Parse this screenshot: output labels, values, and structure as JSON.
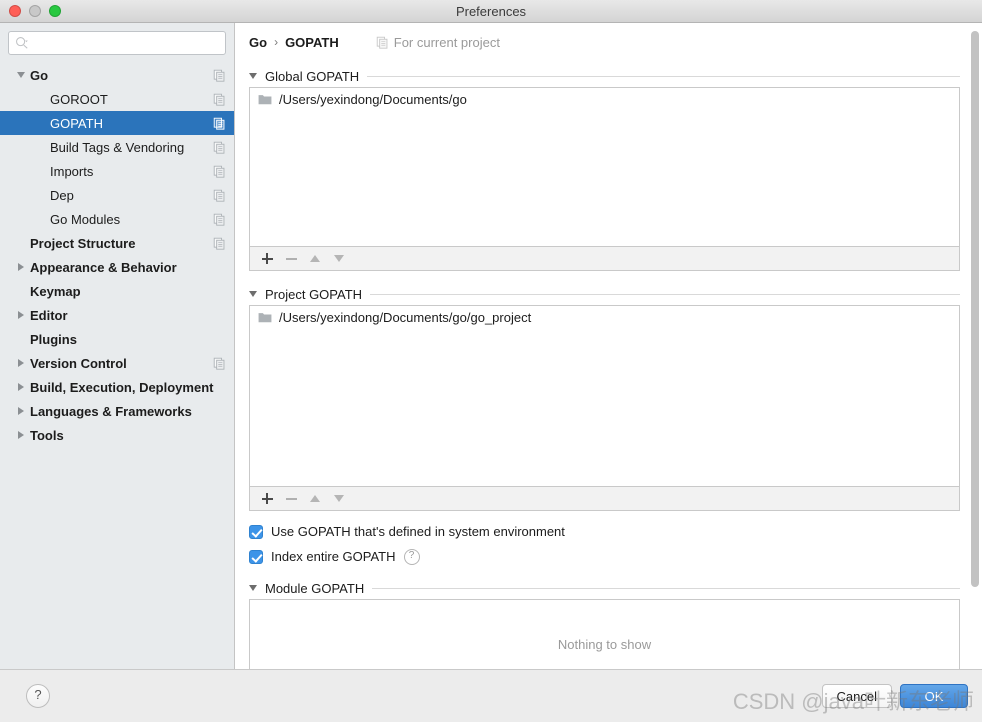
{
  "window": {
    "title": "Preferences",
    "traffic_lights": [
      "close",
      "minimize",
      "zoom"
    ]
  },
  "sidebar": {
    "search": {
      "value": "",
      "placeholder": ""
    },
    "items": [
      {
        "label": "Go",
        "level": 0,
        "expander": "down",
        "bold": true,
        "selected": false,
        "copy": true
      },
      {
        "label": "GOROOT",
        "level": 1,
        "expander": "none",
        "bold": false,
        "selected": false,
        "copy": true
      },
      {
        "label": "GOPATH",
        "level": 1,
        "expander": "none",
        "bold": false,
        "selected": true,
        "copy": true
      },
      {
        "label": "Build Tags & Vendoring",
        "level": 1,
        "expander": "none",
        "bold": false,
        "selected": false,
        "copy": true
      },
      {
        "label": "Imports",
        "level": 1,
        "expander": "none",
        "bold": false,
        "selected": false,
        "copy": true
      },
      {
        "label": "Dep",
        "level": 1,
        "expander": "none",
        "bold": false,
        "selected": false,
        "copy": true
      },
      {
        "label": "Go Modules",
        "level": 1,
        "expander": "none",
        "bold": false,
        "selected": false,
        "copy": true
      },
      {
        "label": "Project Structure",
        "level": 0,
        "expander": "none",
        "bold": true,
        "selected": false,
        "copy": true
      },
      {
        "label": "Appearance & Behavior",
        "level": 0,
        "expander": "right",
        "bold": true,
        "selected": false,
        "copy": false
      },
      {
        "label": "Keymap",
        "level": 0,
        "expander": "none",
        "bold": true,
        "selected": false,
        "copy": false
      },
      {
        "label": "Editor",
        "level": 0,
        "expander": "right",
        "bold": true,
        "selected": false,
        "copy": false
      },
      {
        "label": "Plugins",
        "level": 0,
        "expander": "none",
        "bold": true,
        "selected": false,
        "copy": false
      },
      {
        "label": "Version Control",
        "level": 0,
        "expander": "right",
        "bold": true,
        "selected": false,
        "copy": true
      },
      {
        "label": "Build, Execution, Deployment",
        "level": 0,
        "expander": "right",
        "bold": true,
        "selected": false,
        "copy": false
      },
      {
        "label": "Languages & Frameworks",
        "level": 0,
        "expander": "right",
        "bold": true,
        "selected": false,
        "copy": false
      },
      {
        "label": "Tools",
        "level": 0,
        "expander": "right",
        "bold": true,
        "selected": false,
        "copy": false
      }
    ]
  },
  "main": {
    "breadcrumb": {
      "parent": "Go",
      "separator": "›",
      "current": "GOPATH"
    },
    "for_current_project": "For current project",
    "sections": {
      "global": {
        "title": "Global GOPATH",
        "entries": [
          "/Users/yexindong/Documents/go"
        ]
      },
      "project": {
        "title": "Project GOPATH",
        "entries": [
          "/Users/yexindong/Documents/go/go_project"
        ]
      },
      "module": {
        "title": "Module GOPATH",
        "empty_text": "Nothing to show"
      }
    },
    "toolbar_buttons": [
      "add",
      "remove",
      "move-up",
      "move-down"
    ],
    "checkboxes": [
      {
        "label": "Use GOPATH that's defined in system environment",
        "checked": true,
        "help": false
      },
      {
        "label": "Index entire GOPATH",
        "checked": true,
        "help": true
      }
    ],
    "help_glyph": "?"
  },
  "footer": {
    "help_label": "?",
    "cancel_label": "Cancel",
    "primary_label": "OK"
  },
  "watermark": "CSDN @java叶新东老师",
  "colors": {
    "selection_blue": "#2b74bb",
    "checkbox_blue": "#3d94e8",
    "primary_button": "#3d86d8",
    "sidebar_bg": "#e8ebed"
  }
}
